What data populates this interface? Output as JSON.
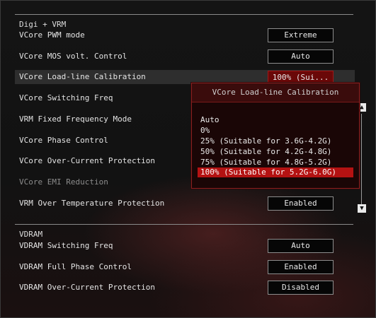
{
  "sections": {
    "digi_vrm": "Digi + VRM",
    "vdram": "VDRAM"
  },
  "rows": [
    {
      "label": "VCore PWM mode",
      "value": "Extreme"
    },
    {
      "label": "VCore MOS volt. Control",
      "value": "Auto"
    },
    {
      "label": "VCore Load-line Calibration",
      "value": "100% (Sui..."
    },
    {
      "label": "VCore Switching Freq",
      "value": ""
    },
    {
      "label": "VRM Fixed Frequency Mode",
      "value": ""
    },
    {
      "label": "VCore Phase Control",
      "value": ""
    },
    {
      "label": "VCore Over-Current Protection",
      "value": ""
    },
    {
      "label": "VCore EMI Reduction",
      "value": ""
    },
    {
      "label": "VRM Over Temperature Protection",
      "value": "Enabled"
    }
  ],
  "vdram_rows": [
    {
      "label": "VDRAM Switching Freq",
      "value": "Auto"
    },
    {
      "label": "VDRAM Full Phase Control",
      "value": "Enabled"
    },
    {
      "label": "VDRAM Over-Current Protection",
      "value": "Disabled"
    }
  ],
  "popup": {
    "title": "VCore Load-line Calibration",
    "options": [
      "Auto",
      "0%",
      "25% (Suitable for 3.6G-4.2G)",
      "50% (Suitable for 4.2G-4.8G)",
      "75% (Suitable for 4.8G-5.2G)",
      "100% (Suitable for 5.2G-6.0G)"
    ],
    "selected_index": 5
  },
  "scrollbar": {
    "up_icon": "▲",
    "down_icon": "▼"
  },
  "colors": {
    "accent_red": "#b41212",
    "popup_bg": "#1a0606"
  }
}
